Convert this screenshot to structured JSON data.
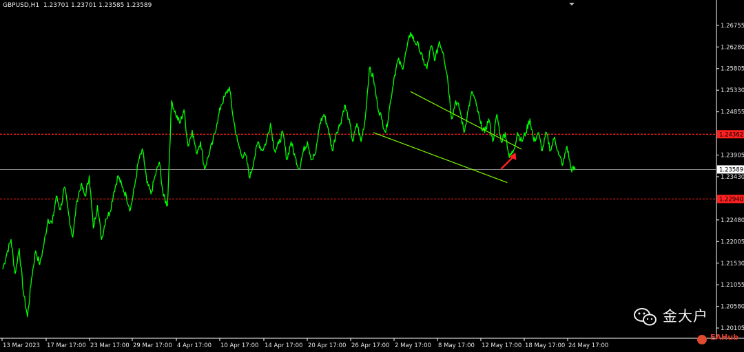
{
  "header": {
    "symbol_text": "GBPUSD,H1",
    "quote": "1.23701 1.23701 1.23585 1.23589"
  },
  "colors": {
    "background": "#000000",
    "price_line": "#00ff00",
    "channel": "#7cfc00",
    "level": "#ff2020",
    "arrow": "#ff2020",
    "axis": "#ffffff"
  },
  "chart_data": {
    "type": "line",
    "title": "",
    "xlabel": "",
    "ylabel": "",
    "ylim": [
      1.1988,
      1.271
    ],
    "y_ticks": [
      "1.26755",
      "1.26280",
      "1.25805",
      "1.25330",
      "1.24855",
      "1.23905",
      "1.23430",
      "1.22480",
      "1.22005",
      "1.21530",
      "1.21055",
      "1.20580",
      "1.20105"
    ],
    "x_ticks": [
      "13 Mar 2023",
      "17 Mar 17:00",
      "23 Mar 17:00",
      "29 Mar 17:00",
      "4 Apr 17:00",
      "10 Apr 17:00",
      "14 Apr 17:00",
      "20 Apr 17:00",
      "26 Apr 17:00",
      "2 May 17:00",
      "8 May 17:00",
      "12 May 17:00",
      "18 May 17:00",
      "24 May 17:00"
    ],
    "current_price": "1.23589",
    "levels": [
      "1.24362",
      "1.22940"
    ],
    "series": [
      {
        "values": [
          1.214,
          1.2175,
          1.2205,
          1.213,
          1.2185,
          1.209,
          1.2035,
          1.212,
          1.218,
          1.215,
          1.2195,
          1.225,
          1.224,
          1.23,
          1.227,
          1.232,
          1.226,
          1.221,
          1.229,
          1.2325,
          1.23,
          1.2345,
          1.223,
          1.228,
          1.2205,
          1.225,
          1.2265,
          1.231,
          1.2345,
          1.232,
          1.23,
          1.227,
          1.232,
          1.238,
          1.24,
          1.233,
          1.2305,
          1.2345,
          1.2375,
          1.23,
          1.228,
          1.251,
          1.248,
          1.246,
          1.249,
          1.241,
          1.2445,
          1.2395,
          1.242,
          1.236,
          1.239,
          1.242,
          1.246,
          1.25,
          1.252,
          1.254,
          1.247,
          1.242,
          1.239,
          1.239,
          1.234,
          1.238,
          1.242,
          1.24,
          1.242,
          1.246,
          1.24,
          1.2415,
          1.244,
          1.238,
          1.242,
          1.2385,
          1.236,
          1.24,
          1.242,
          1.238,
          1.2395,
          1.246,
          1.248,
          1.245,
          1.24,
          1.244,
          1.246,
          1.25,
          1.247,
          1.242,
          1.246,
          1.242,
          1.247,
          1.258,
          1.256,
          1.25,
          1.247,
          1.244,
          1.25,
          1.256,
          1.26,
          1.258,
          1.262,
          1.266,
          1.264,
          1.263,
          1.26,
          1.258,
          1.263,
          1.26,
          1.264,
          1.2615,
          1.256,
          1.247,
          1.251,
          1.249,
          1.244,
          1.249,
          1.253,
          1.25,
          1.246,
          1.244,
          1.247,
          1.242,
          1.248,
          1.242,
          1.244,
          1.2385,
          1.24,
          1.244,
          1.242,
          1.244,
          1.247,
          1.242,
          1.244,
          1.24,
          1.244,
          1.24,
          1.243,
          1.239,
          1.237,
          1.241,
          1.236,
          1.2359
        ]
      }
    ],
    "channel": {
      "upper": [
        [
          99.0,
          1.253
        ],
        [
          126.0,
          1.2403
        ]
      ],
      "lower": [
        [
          90.0,
          1.244
        ],
        [
          122.5,
          1.233
        ]
      ]
    },
    "arrow": [
      [
        121.0,
        1.236
      ],
      [
        124.5,
        1.2396
      ]
    ]
  },
  "watermark": {
    "name": "金大户",
    "brand": "EAHub"
  }
}
